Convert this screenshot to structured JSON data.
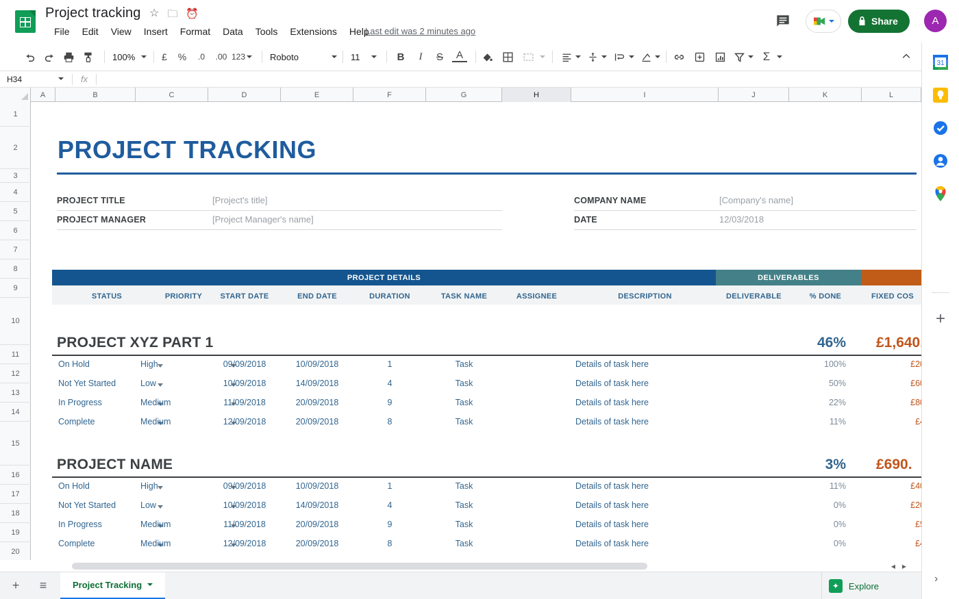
{
  "app": {
    "doc_title": "Project tracking",
    "last_edit": "Last edit was 2 minutes ago",
    "share_label": "Share",
    "avatar_initial": "A",
    "title_icons": [
      "star-icon",
      "move-to-folder-icon",
      "cloud-saved-icon"
    ]
  },
  "menus": [
    "File",
    "Edit",
    "View",
    "Insert",
    "Format",
    "Data",
    "Tools",
    "Extensions",
    "Help"
  ],
  "toolbar": {
    "zoom": "100%",
    "currency_symbol": "£",
    "percent_symbol": "%",
    "dec_decrease": ".0",
    "dec_increase": ".00",
    "number_format": "123",
    "font": "Roboto",
    "font_size": "11",
    "bold": "B",
    "italic": "I",
    "strikethrough": "S",
    "text_color": "A"
  },
  "formula_bar": {
    "name_box": "H34",
    "fx": "fx",
    "formula": ""
  },
  "grid": {
    "columns": [
      "A",
      "B",
      "C",
      "D",
      "E",
      "F",
      "G",
      "H",
      "I",
      "J",
      "K",
      "L"
    ],
    "selected_column": "H",
    "rows": [
      "1",
      "2",
      "3",
      "4",
      "5",
      "6",
      "7",
      "8",
      "9",
      "10",
      "11",
      "12",
      "13",
      "14",
      "15",
      "16",
      "17",
      "18",
      "19",
      "20"
    ]
  },
  "sheet_content": {
    "title": "PROJECT TRACKING",
    "info_left": [
      {
        "label": "PROJECT TITLE",
        "value": "[Project's title]"
      },
      {
        "label": "PROJECT MANAGER",
        "value": "[Project Manager's name]"
      }
    ],
    "info_right": [
      {
        "label": "COMPANY NAME",
        "value": "[Company's name]"
      },
      {
        "label": "DATE",
        "value": "12/03/2018"
      }
    ],
    "bands": [
      {
        "label": "PROJECT DETAILS",
        "color": "#14558f"
      },
      {
        "label": "DELIVERABLES",
        "color": "#448087"
      },
      {
        "label": "",
        "color": "#c05c17"
      }
    ],
    "column_headers": [
      "STATUS",
      "PRIORITY",
      "START DATE",
      "END DATE",
      "DURATION",
      "TASK NAME",
      "ASSIGNEE",
      "DESCRIPTION",
      "DELIVERABLE",
      "% DONE",
      "FIXED COS"
    ],
    "sections": [
      {
        "name": "PROJECT XYZ PART 1",
        "percent": "46%",
        "cost": "£1,640.",
        "rows": [
          {
            "status": "On Hold",
            "priority": "High",
            "start": "09/09/2018",
            "end": "10/09/2018",
            "duration": "1",
            "task": "Task",
            "assignee": "",
            "description": "Details of task here",
            "deliverable": "",
            "done": "100%",
            "cost": "£20"
          },
          {
            "status": "Not Yet Started",
            "priority": "Low",
            "start": "10/09/2018",
            "end": "14/09/2018",
            "duration": "4",
            "task": "Task",
            "assignee": "",
            "description": "Details of task here",
            "deliverable": "",
            "done": "50%",
            "cost": "£60"
          },
          {
            "status": "In Progress",
            "priority": "Medium",
            "start": "11/09/2018",
            "end": "20/09/2018",
            "duration": "9",
            "task": "Task",
            "assignee": "",
            "description": "Details of task here",
            "deliverable": "",
            "done": "22%",
            "cost": "£80"
          },
          {
            "status": "Complete",
            "priority": "Medium",
            "start": "12/09/2018",
            "end": "20/09/2018",
            "duration": "8",
            "task": "Task",
            "assignee": "",
            "description": "Details of task here",
            "deliverable": "",
            "done": "11%",
            "cost": "£4"
          }
        ]
      },
      {
        "name": "PROJECT NAME",
        "percent": "3%",
        "cost": "£690.",
        "rows": [
          {
            "status": "On Hold",
            "priority": "High",
            "start": "09/09/2018",
            "end": "10/09/2018",
            "duration": "1",
            "task": "Task",
            "assignee": "",
            "description": "Details of task here",
            "deliverable": "",
            "done": "11%",
            "cost": "£40"
          },
          {
            "status": "Not Yet Started",
            "priority": "Low",
            "start": "10/09/2018",
            "end": "14/09/2018",
            "duration": "4",
            "task": "Task",
            "assignee": "",
            "description": "Details of task here",
            "deliverable": "",
            "done": "0%",
            "cost": "£20"
          },
          {
            "status": "In Progress",
            "priority": "Medium",
            "start": "11/09/2018",
            "end": "20/09/2018",
            "duration": "9",
            "task": "Task",
            "assignee": "",
            "description": "Details of task here",
            "deliverable": "",
            "done": "0%",
            "cost": "£5"
          },
          {
            "status": "Complete",
            "priority": "Medium",
            "start": "12/09/2018",
            "end": "20/09/2018",
            "duration": "8",
            "task": "Task",
            "assignee": "",
            "description": "Details of task here",
            "deliverable": "",
            "done": "0%",
            "cost": "£4"
          }
        ]
      }
    ]
  },
  "bottom": {
    "add_sheet": "+",
    "all_sheets": "≡",
    "sheet_tab": "Project Tracking",
    "explore": "Explore"
  },
  "side_panel": {
    "icons": [
      "google-calendar-icon",
      "google-keep-icon",
      "google-tasks-icon",
      "google-contacts-icon",
      "google-maps-icon"
    ],
    "add": "+"
  },
  "colors": {
    "accent_blue": "#1f5c9e",
    "band_blue": "#14558f",
    "band_teal": "#448087",
    "band_orange": "#c05c17",
    "share_green": "#137333",
    "cost_orange": "#c0551b",
    "text_blue": "#31658f",
    "avatar_purple": "#9c27b0"
  }
}
